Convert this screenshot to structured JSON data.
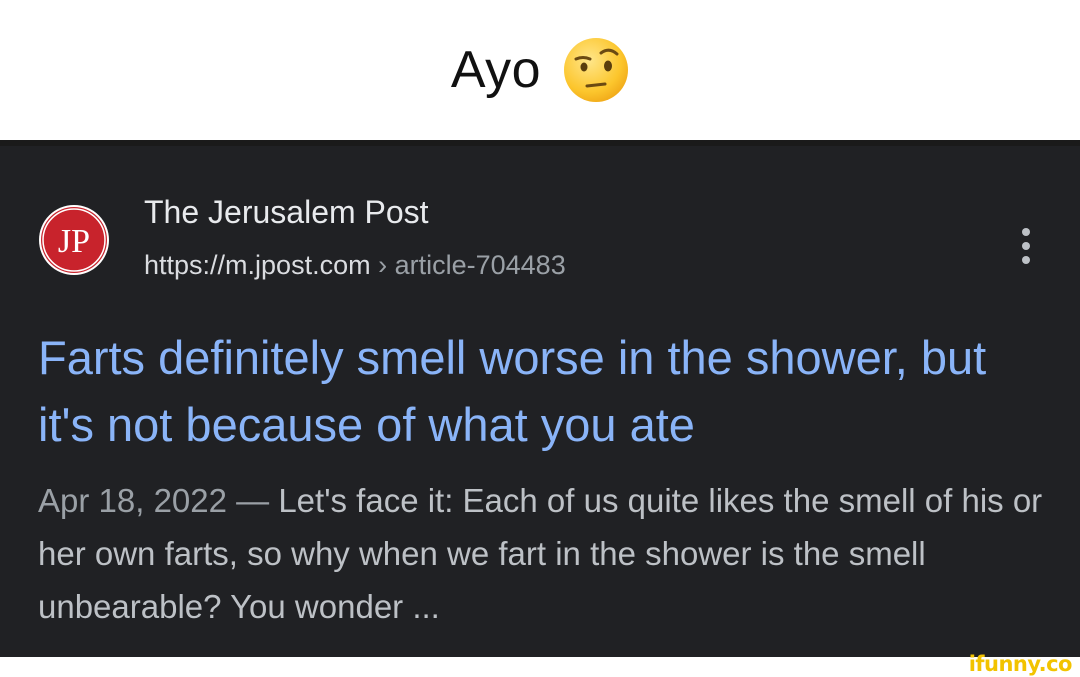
{
  "caption": {
    "text": "Ayo",
    "emoji": "face-with-raised-eyebrow-emoji"
  },
  "result": {
    "site_name": "The Jerusalem Post",
    "logo_text": "JP",
    "url_domain": "https://m.jpost.com",
    "url_separator": "›",
    "url_path": "article-704483",
    "more_icon": "three-dot-vertical-icon",
    "headline": "Farts definitely smell worse in the shower, but it's not because of what you ate",
    "snippet_date": "Apr 18, 2022 — ",
    "snippet_text": "Let's face it: Each of us quite likes the smell of his or her own farts, so why when we fart in the shower is the smell unbearable? You wonder ..."
  },
  "watermark": {
    "text": "ifunny.co"
  },
  "colors": {
    "card_background": "#202124",
    "headline": "#8ab4f8",
    "site_name": "#e8eaed",
    "snippet": "#bdc1c6",
    "logo_red": "#c8232c",
    "watermark": "#f2c300"
  }
}
